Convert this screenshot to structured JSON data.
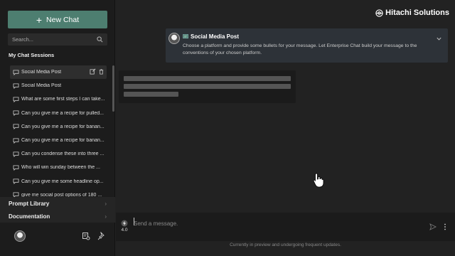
{
  "sidebar": {
    "new_chat_label": "New Chat",
    "search_placeholder": "Search...",
    "sessions_title": "My Chat Sessions",
    "sessions": [
      {
        "label": "Social Media Post",
        "active": true
      },
      {
        "label": "Social Media Post"
      },
      {
        "label": "What are some first steps I can take..."
      },
      {
        "label": "Can you give me a recipe for pulled..."
      },
      {
        "label": "Can you give me a recipe for banan..."
      },
      {
        "label": "Can you give me a recipe for banan..."
      },
      {
        "label": "Can you condense these into three ..."
      },
      {
        "label": "Who will win sunday between the ..."
      },
      {
        "label": "Can you give me some headline op..."
      },
      {
        "label": "give me social post options of 180 ..."
      }
    ],
    "nav": {
      "prompt_library": "Prompt Library",
      "documentation": "Documentation"
    }
  },
  "header": {
    "brand": "Hitachi Solutions"
  },
  "prompt_card": {
    "title": "Social Media Post",
    "text": "Choose a platform and provide some bullets for your message.  Let Enterprise Chat build your message to the conventions of your chosen platform."
  },
  "composer": {
    "placeholder": "Send a message.",
    "model": "4.0"
  },
  "footer_note": "Currently in preview and undergoing frequent updates.",
  "colors": {
    "accent": "#4d7e70",
    "sidebar_bg": "#1c1c1c",
    "main_bg": "#222222",
    "card_bg": "#2d3238"
  }
}
